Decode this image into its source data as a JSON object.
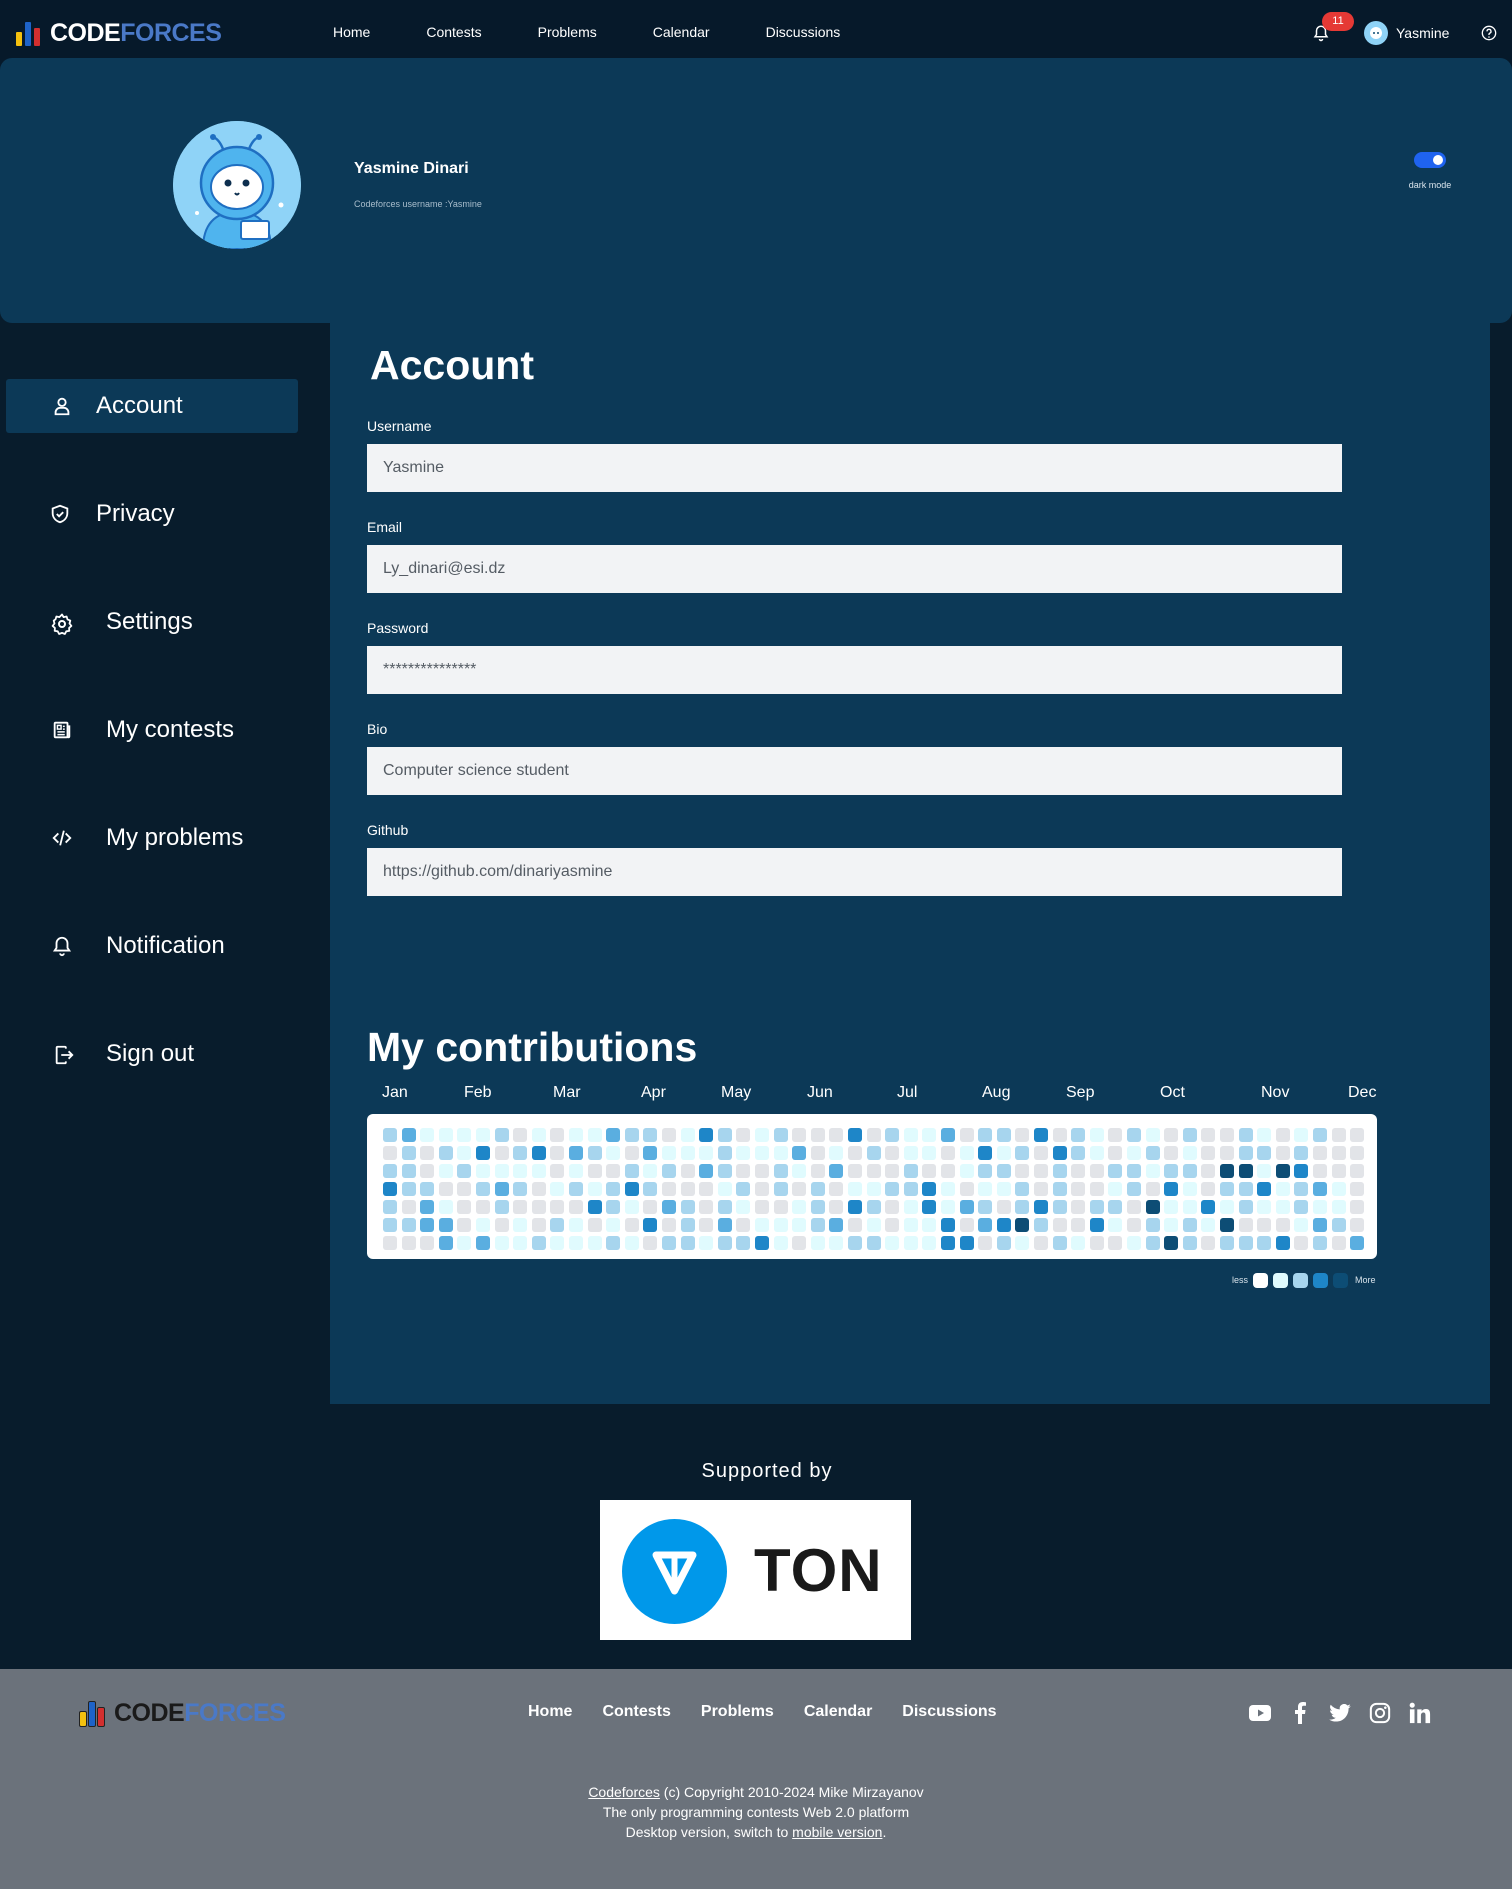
{
  "brand": {
    "code": "CODE",
    "forces": "FORCES"
  },
  "nav": {
    "links": [
      "Home",
      "Contests",
      "Problems",
      "Calendar",
      "Discussions"
    ]
  },
  "notifications": {
    "count": "11"
  },
  "user": {
    "name": "Yasmine"
  },
  "profile": {
    "full_name": "Yasmine Dinari",
    "handle_line": "Codeforces username :Yasmine",
    "toggle_label": "dark mode",
    "dark_mode": true
  },
  "sidebar": {
    "items": [
      {
        "label": "Account",
        "icon": "user-icon",
        "active": true
      },
      {
        "label": "Privacy",
        "icon": "shield-icon",
        "active": false
      },
      {
        "label": "Settings",
        "icon": "gear-icon",
        "active": false
      },
      {
        "label": "My contests",
        "icon": "newspaper-icon",
        "active": false
      },
      {
        "label": "My problems",
        "icon": "code-icon",
        "active": false
      },
      {
        "label": "Notification",
        "icon": "bell-icon",
        "active": false
      },
      {
        "label": "Sign out",
        "icon": "sign-out-icon",
        "active": false
      }
    ]
  },
  "account": {
    "title": "Account",
    "fields": [
      {
        "label": "Username",
        "value": "Yasmine"
      },
      {
        "label": "Email",
        "value": "Ly_dinari@esi.dz"
      },
      {
        "label": "Password",
        "value": "***************"
      },
      {
        "label": "Bio",
        "value": "Computer science student"
      },
      {
        "label": "Github",
        "value": "https://github.com/dinariyasmine"
      }
    ]
  },
  "contributions": {
    "title": "My contributions",
    "months": [
      "Jan",
      "Feb",
      "Mar",
      "Apr",
      "May",
      "Jun",
      "Jul",
      "Aug",
      "Sep",
      "Oct",
      "Nov",
      "Dec"
    ],
    "legend_less": "less",
    "legend_more": "More",
    "colors": [
      "#ffffff",
      "#e2e4e8",
      "#e0fbfe",
      "#a7d5ee",
      "#5aaee0",
      "#1e86c8",
      "#0d4d75"
    ],
    "weeks": 53,
    "days": 7
  },
  "supported": {
    "title": "Supported by",
    "sponsor": "TON"
  },
  "footer": {
    "links": [
      "Home",
      "Contests",
      "Problems",
      "Calendar",
      "Discussions"
    ],
    "socials": [
      "youtube-icon",
      "facebook-icon",
      "twitter-icon",
      "instagram-icon",
      "linkedin-icon"
    ],
    "copy_link": "Codeforces",
    "copy_rest": " (c) Copyright 2010-2024 Mike Mirzayanov",
    "tagline": "The only programming contests Web 2.0 platform",
    "desktop_prefix": "Desktop version, switch to ",
    "mobile_link": "mobile version",
    "desktop_suffix": "."
  }
}
